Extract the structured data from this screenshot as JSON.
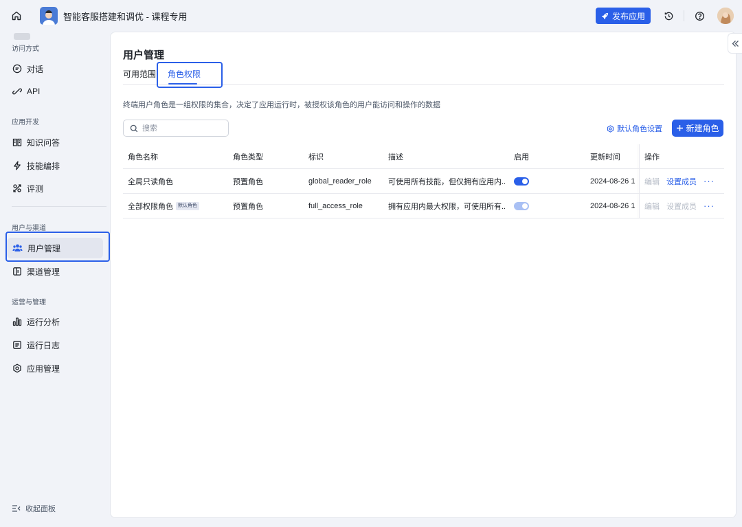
{
  "header": {
    "app_title": "智能客服搭建和调优 - 课程专用",
    "publish_label": "发布应用"
  },
  "sidebar": {
    "sections": [
      {
        "title": "访问方式",
        "items": [
          {
            "label": "对话",
            "icon": "chat-icon"
          },
          {
            "label": "API",
            "icon": "api-icon"
          }
        ]
      },
      {
        "title": "应用开发",
        "items": [
          {
            "label": "知识问答",
            "icon": "book-icon"
          },
          {
            "label": "技能编排",
            "icon": "lightning-icon"
          },
          {
            "label": "评测",
            "icon": "evaluate-icon"
          }
        ]
      },
      {
        "title": "用户与渠道",
        "items": [
          {
            "label": "用户管理",
            "icon": "users-icon",
            "active": true
          },
          {
            "label": "渠道管理",
            "icon": "channel-icon"
          }
        ]
      },
      {
        "title": "运营与管理",
        "items": [
          {
            "label": "运行分析",
            "icon": "bar-chart-icon"
          },
          {
            "label": "运行日志",
            "icon": "log-icon"
          },
          {
            "label": "应用管理",
            "icon": "gear-icon"
          }
        ]
      }
    ],
    "collapse_label": "收起面板"
  },
  "main": {
    "title": "用户管理",
    "tabs": [
      {
        "label": "可用范围",
        "active": false
      },
      {
        "label": "角色权限",
        "active": true
      }
    ],
    "description": "终端用户角色是一组权限的集合，决定了应用运行时，被授权该角色的用户能访问和操作的数据",
    "search_placeholder": "搜索",
    "default_role_label": "默认角色设置",
    "new_role_label": "新建角色",
    "table": {
      "headers": [
        "角色名称",
        "角色类型",
        "标识",
        "描述",
        "启用",
        "更新时间",
        "操作"
      ],
      "rows": [
        {
          "name": "全局只读角色",
          "badge": "",
          "type": "预置角色",
          "id": "global_reader_role",
          "desc": "可使用所有技能，但仅拥有应用内...",
          "enabled": true,
          "enabled_disabled": false,
          "time": "2024-08-26 1",
          "edit": "编辑",
          "members": "设置成员",
          "members_disabled": false,
          "more": "···"
        },
        {
          "name": "全部权限角色",
          "badge": "默认角色",
          "type": "预置角色",
          "id": "full_access_role",
          "desc": "拥有应用内最大权限，可使用所有...",
          "enabled": true,
          "enabled_disabled": true,
          "time": "2024-08-26 1",
          "edit": "编辑",
          "members": "设置成员",
          "members_disabled": true,
          "more": "···"
        }
      ]
    }
  },
  "colors": {
    "accent": "#2a5fe8",
    "highlight_frame": "#2a5fe8"
  }
}
